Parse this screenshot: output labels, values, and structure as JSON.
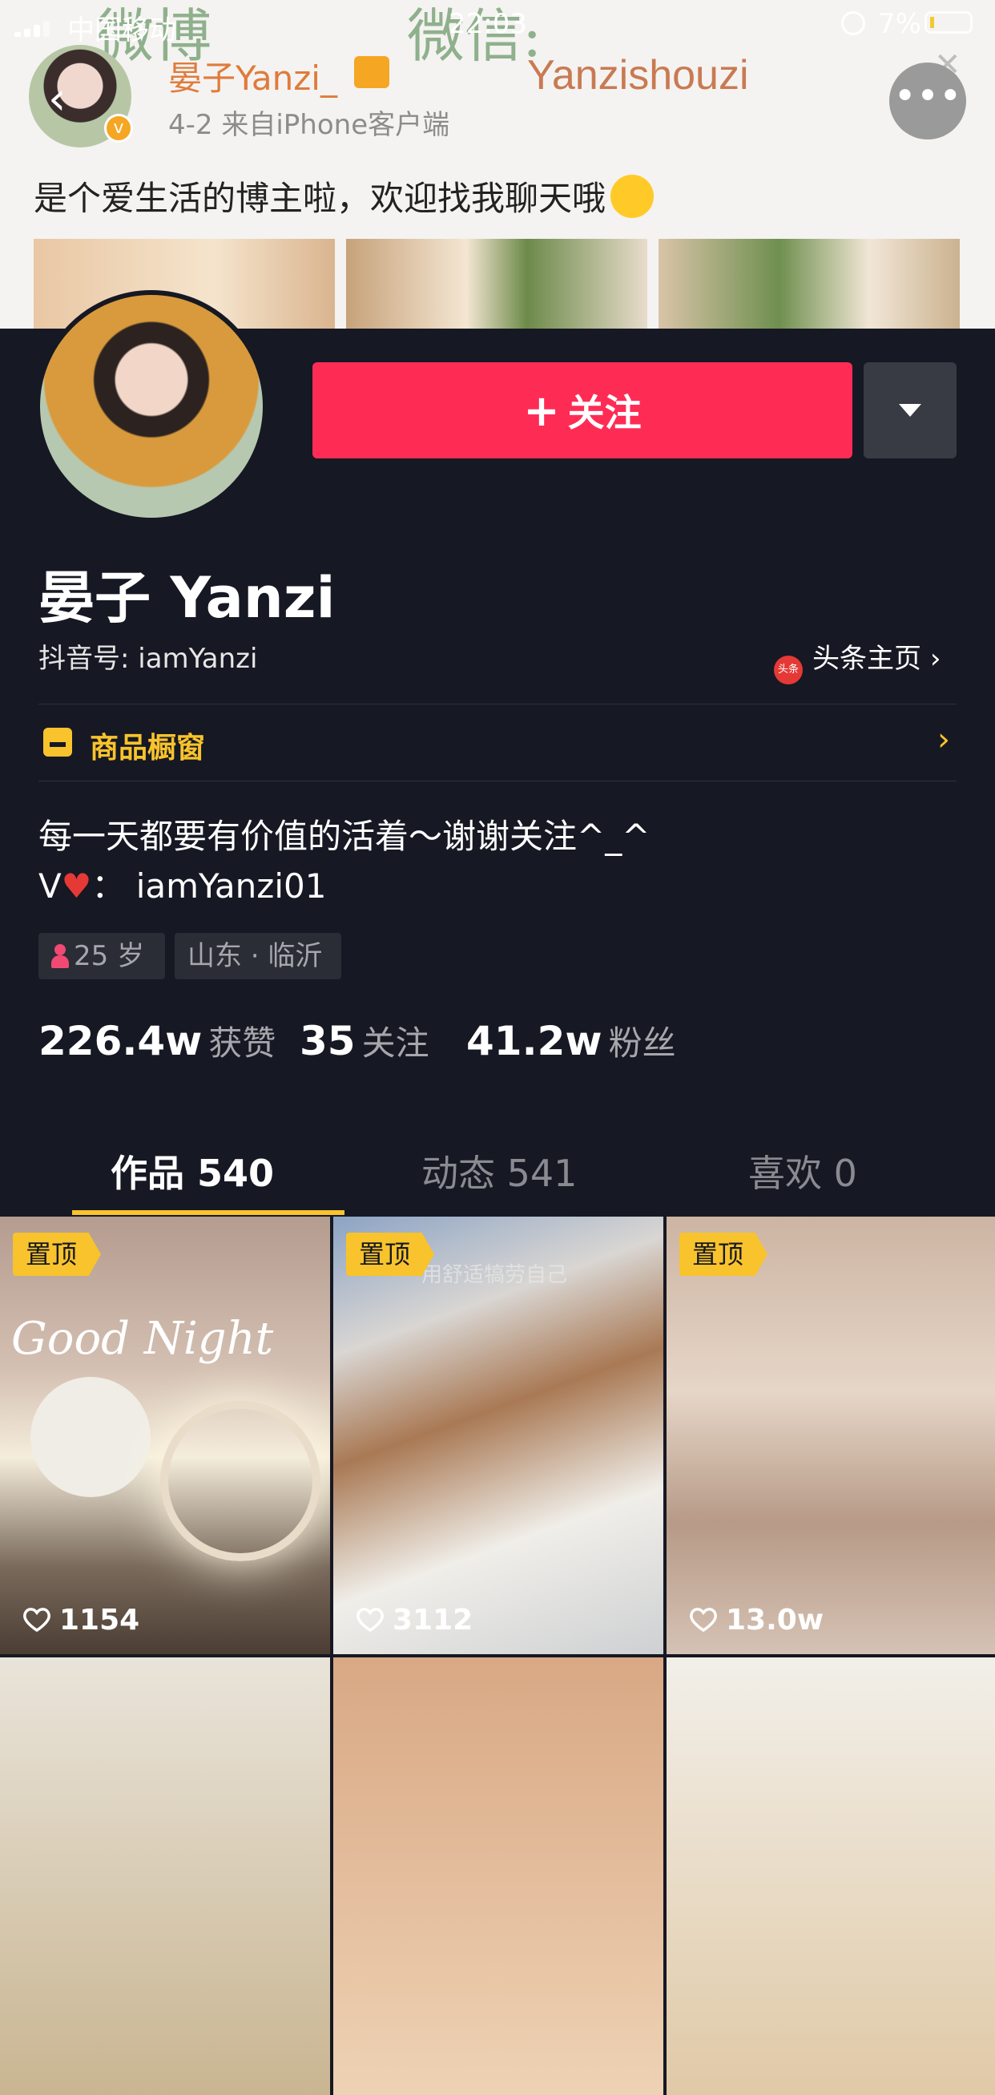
{
  "status_bar": {
    "carrier": "中国移动",
    "time": "22:03",
    "battery": "7%"
  },
  "weibo_post": {
    "watermark_1": "微博",
    "watermark_2": "微信:",
    "watermark_id": "Yanzishouzi",
    "author": "晏子Yanzi_",
    "meta": "4-2  来自iPhone客户端",
    "text": "是个爱生活的博主啦，欢迎找我聊天哦"
  },
  "profile": {
    "follow_label": "关注",
    "nickname": "晏子 Yanzi",
    "douyin_id": "抖音号: iamYanzi",
    "toutiao_link": "头条主页",
    "toutiao_icon_text": "头条",
    "shop_label": "商品橱窗",
    "bio_line1": "每一天都要有价值的活着～谢谢关注^_^",
    "bio_line2_prefix": "V",
    "bio_line2_suffix": "：  iamYanzi01",
    "tags": {
      "age": "25 岁",
      "location": "山东 · 临沂"
    },
    "stats": {
      "likes_value": "226.4w",
      "likes_label": "获赞",
      "following_value": "35",
      "following_label": "关注",
      "followers_value": "41.2w",
      "followers_label": "粉丝"
    }
  },
  "tabs": [
    {
      "label": "作品 540"
    },
    {
      "label": "动态 541"
    },
    {
      "label": "喜欢 0"
    }
  ],
  "videos": [
    {
      "pinned": "置顶",
      "likes": "1154",
      "overlay": "Good Night"
    },
    {
      "pinned": "置顶",
      "likes": "3112",
      "overlay": "用舒适犒劳自己"
    },
    {
      "pinned": "置顶",
      "likes": "13.0w"
    }
  ],
  "colors": {
    "accent": "#fe2c55",
    "background": "#161823",
    "highlight": "#f8c32c"
  }
}
